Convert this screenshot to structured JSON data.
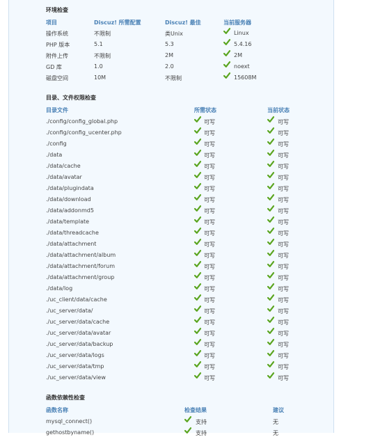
{
  "env": {
    "title": "环境检查",
    "headers": [
      "项目",
      "Discuz! 所需配置",
      "Discuz! 最佳",
      "当前服务器"
    ],
    "rows": [
      [
        "操作系统",
        "不限制",
        "类Unix",
        "Linux"
      ],
      [
        "PHP 版本",
        "5.1",
        "5.3",
        "5.4.16"
      ],
      [
        "附件上传",
        "不限制",
        "2M",
        "2M"
      ],
      [
        "GD 库",
        "1.0",
        "2.0",
        "noext"
      ],
      [
        "磁盘空间",
        "10M",
        "不限制",
        "15608M"
      ]
    ]
  },
  "dirs": {
    "title": "目录、文件权限检查",
    "headers": [
      "目录文件",
      "所需状态",
      "当前状态"
    ],
    "rows": [
      [
        "./config/config_global.php",
        "可写",
        "可写"
      ],
      [
        "./config/config_ucenter.php",
        "可写",
        "可写"
      ],
      [
        "./config",
        "可写",
        "可写"
      ],
      [
        "./data",
        "可写",
        "可写"
      ],
      [
        "./data/cache",
        "可写",
        "可写"
      ],
      [
        "./data/avatar",
        "可写",
        "可写"
      ],
      [
        "./data/plugindata",
        "可写",
        "可写"
      ],
      [
        "./data/download",
        "可写",
        "可写"
      ],
      [
        "./data/addonmd5",
        "可写",
        "可写"
      ],
      [
        "./data/template",
        "可写",
        "可写"
      ],
      [
        "./data/threadcache",
        "可写",
        "可写"
      ],
      [
        "./data/attachment",
        "可写",
        "可写"
      ],
      [
        "./data/attachment/album",
        "可写",
        "可写"
      ],
      [
        "./data/attachment/forum",
        "可写",
        "可写"
      ],
      [
        "./data/attachment/group",
        "可写",
        "可写"
      ],
      [
        "./data/log",
        "可写",
        "可写"
      ],
      [
        "./uc_client/data/cache",
        "可写",
        "可写"
      ],
      [
        "./uc_server/data/",
        "可写",
        "可写"
      ],
      [
        "./uc_server/data/cache",
        "可写",
        "可写"
      ],
      [
        "./uc_server/data/avatar",
        "可写",
        "可写"
      ],
      [
        "./uc_server/data/backup",
        "可写",
        "可写"
      ],
      [
        "./uc_server/data/logs",
        "可写",
        "可写"
      ],
      [
        "./uc_server/data/tmp",
        "可写",
        "可写"
      ],
      [
        "./uc_server/data/view",
        "可写",
        "可写"
      ]
    ]
  },
  "funcs": {
    "title": "函数依赖性检查",
    "headers": [
      "函数名称",
      "检查结果",
      "建议"
    ],
    "rows": [
      [
        "mysql_connect()",
        "支持",
        "无"
      ],
      [
        "gethostbyname()",
        "支持",
        "无"
      ]
    ]
  },
  "colors": {
    "check": "#5aa51f",
    "header": "#4b82b6",
    "panel": "#f3f9fe"
  },
  "icons": {
    "status": "check-icon"
  }
}
